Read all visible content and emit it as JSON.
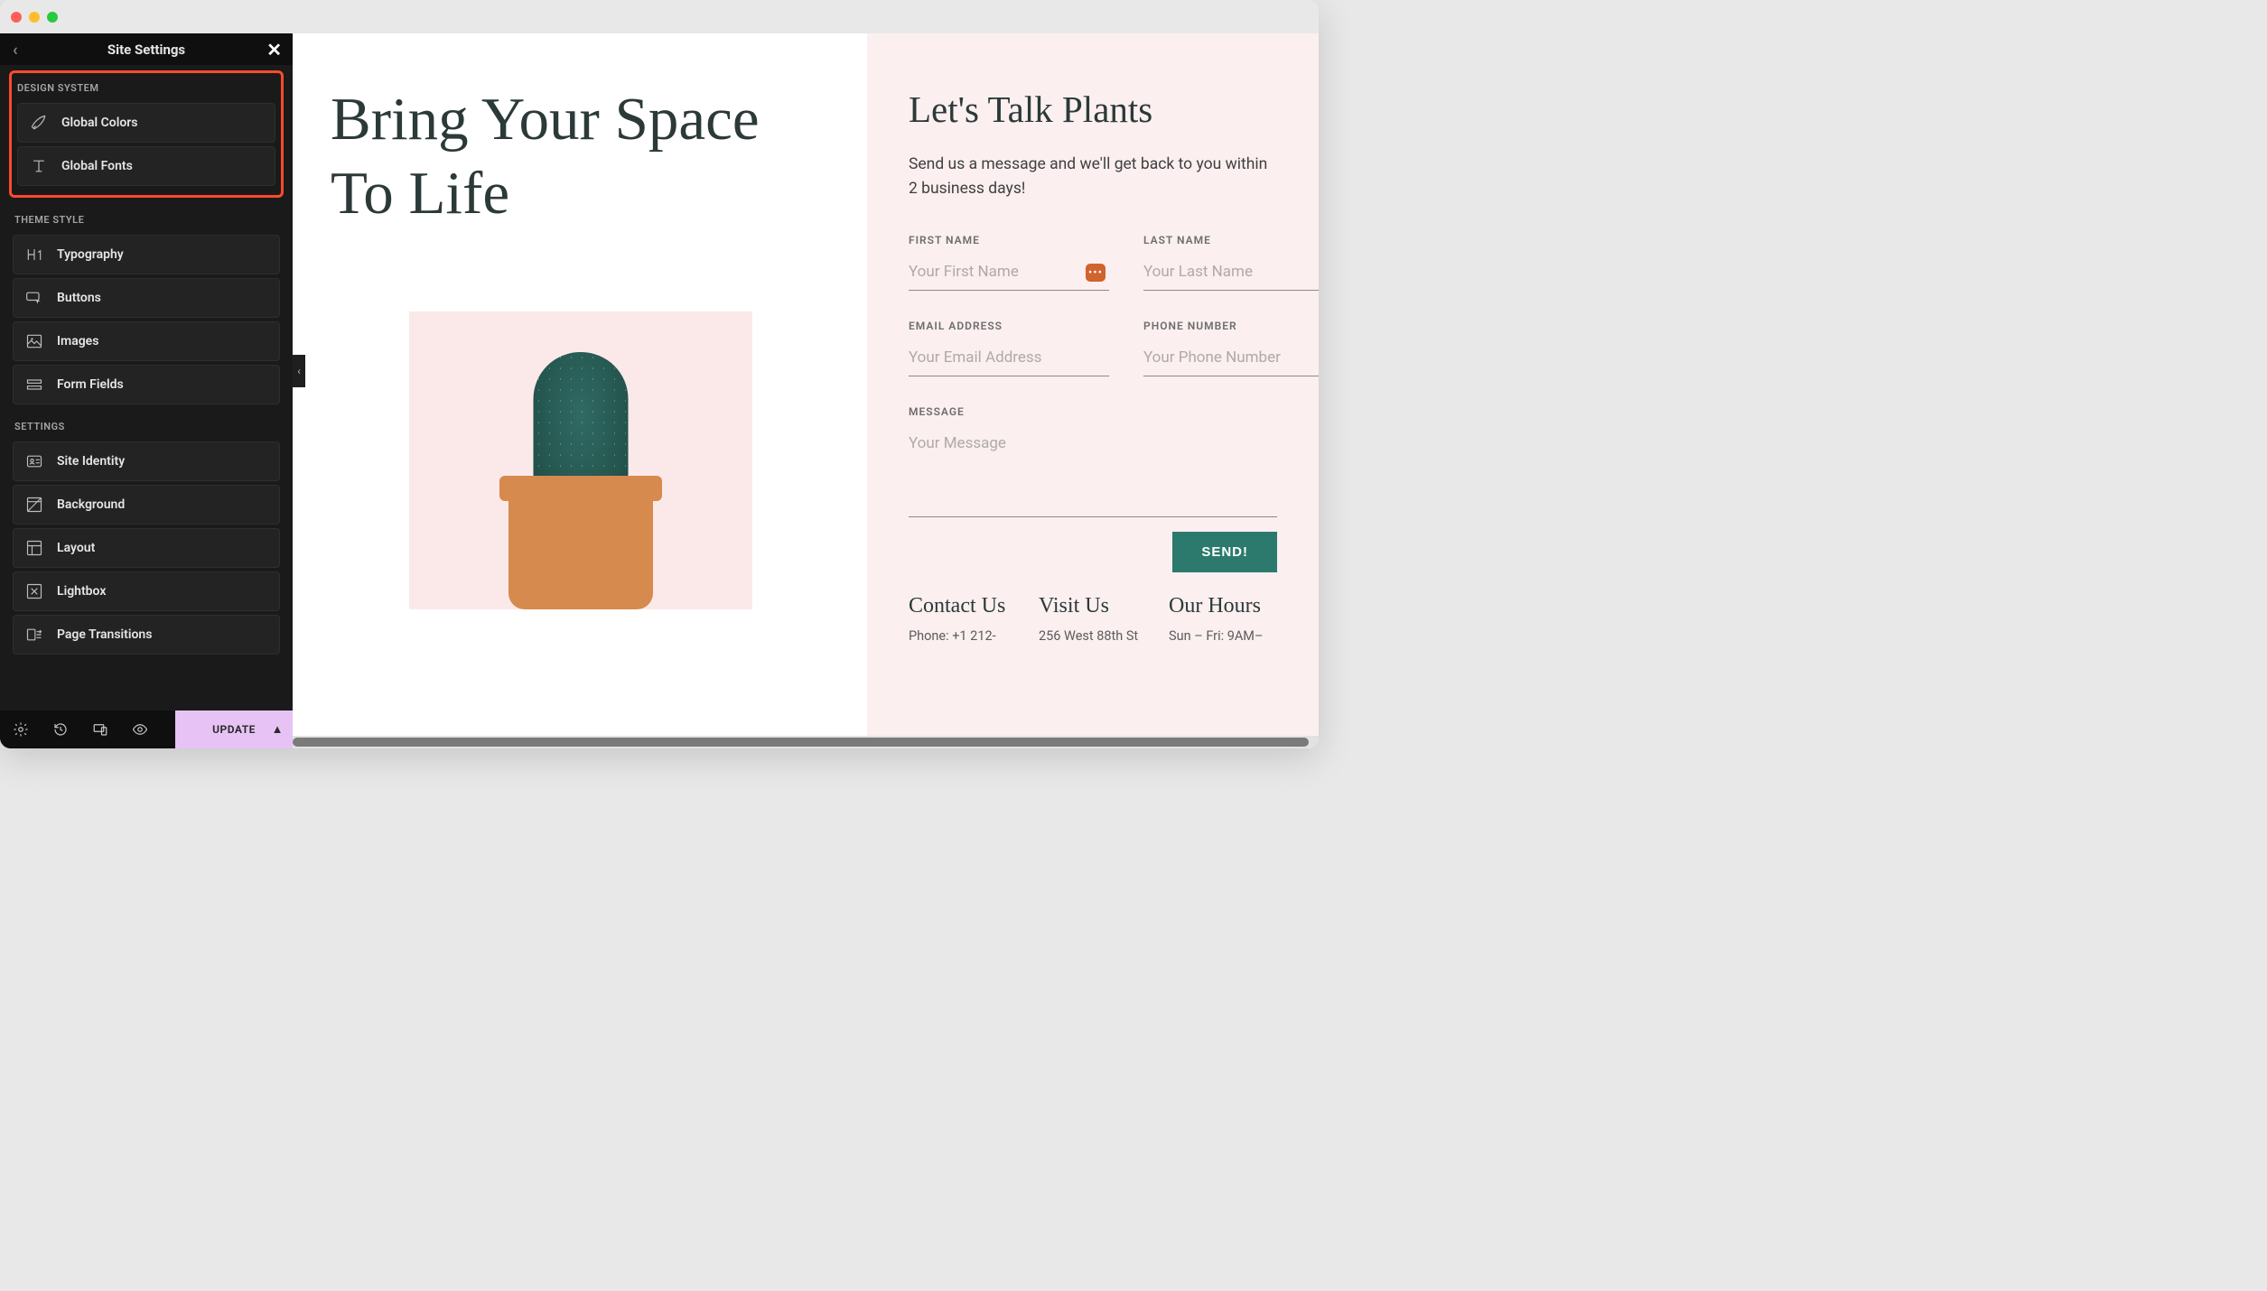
{
  "window": {
    "title": ""
  },
  "sidebar": {
    "headerTitle": "Site Settings",
    "sections": {
      "designSystem": {
        "title": "DESIGN SYSTEM",
        "items": [
          {
            "label": "Global Colors",
            "icon": "brush-icon"
          },
          {
            "label": "Global Fonts",
            "icon": "type-icon"
          }
        ]
      },
      "themeStyle": {
        "title": "THEME STYLE",
        "items": [
          {
            "label": "Typography",
            "icon": "h1-icon"
          },
          {
            "label": "Buttons",
            "icon": "cursor-button-icon"
          },
          {
            "label": "Images",
            "icon": "image-icon"
          },
          {
            "label": "Form Fields",
            "icon": "form-icon"
          }
        ]
      },
      "settings": {
        "title": "SETTINGS",
        "items": [
          {
            "label": "Site Identity",
            "icon": "id-icon"
          },
          {
            "label": "Background",
            "icon": "background-icon"
          },
          {
            "label": "Layout",
            "icon": "layout-icon"
          },
          {
            "label": "Lightbox",
            "icon": "lightbox-icon"
          },
          {
            "label": "Page Transitions",
            "icon": "transition-icon"
          }
        ]
      }
    },
    "updateLabel": "UPDATE"
  },
  "preview": {
    "hero": {
      "headline": "Bring Your Space To Life"
    },
    "contact": {
      "title": "Let's Talk Plants",
      "subtitle": "Send us a message and we'll get back to you within 2 business days!",
      "fields": {
        "firstName": {
          "label": "FIRST NAME",
          "placeholder": "Your First Name"
        },
        "lastName": {
          "label": "LAST NAME",
          "placeholder": "Your Last Name"
        },
        "email": {
          "label": "EMAIL ADDRESS",
          "placeholder": "Your Email Address"
        },
        "phone": {
          "label": "PHONE NUMBER",
          "placeholder": "Your Phone Number"
        },
        "message": {
          "label": "MESSAGE",
          "placeholder": "Your Message"
        }
      },
      "submitLabel": "SEND!",
      "info": {
        "contactUs": {
          "title": "Contact Us",
          "body": "Phone: +1 212-"
        },
        "visitUs": {
          "title": "Visit Us",
          "body": "256 West 88th St"
        },
        "hours": {
          "title": "Our Hours",
          "body": "Sun – Fri: 9AM–"
        }
      }
    }
  },
  "colors": {
    "highlight": "#ff4a2e",
    "accent": "#2c7a6e",
    "update": "#e7c3f5",
    "sidebarBg": "#1a1a1a",
    "contactBg": "#fbeff0"
  }
}
